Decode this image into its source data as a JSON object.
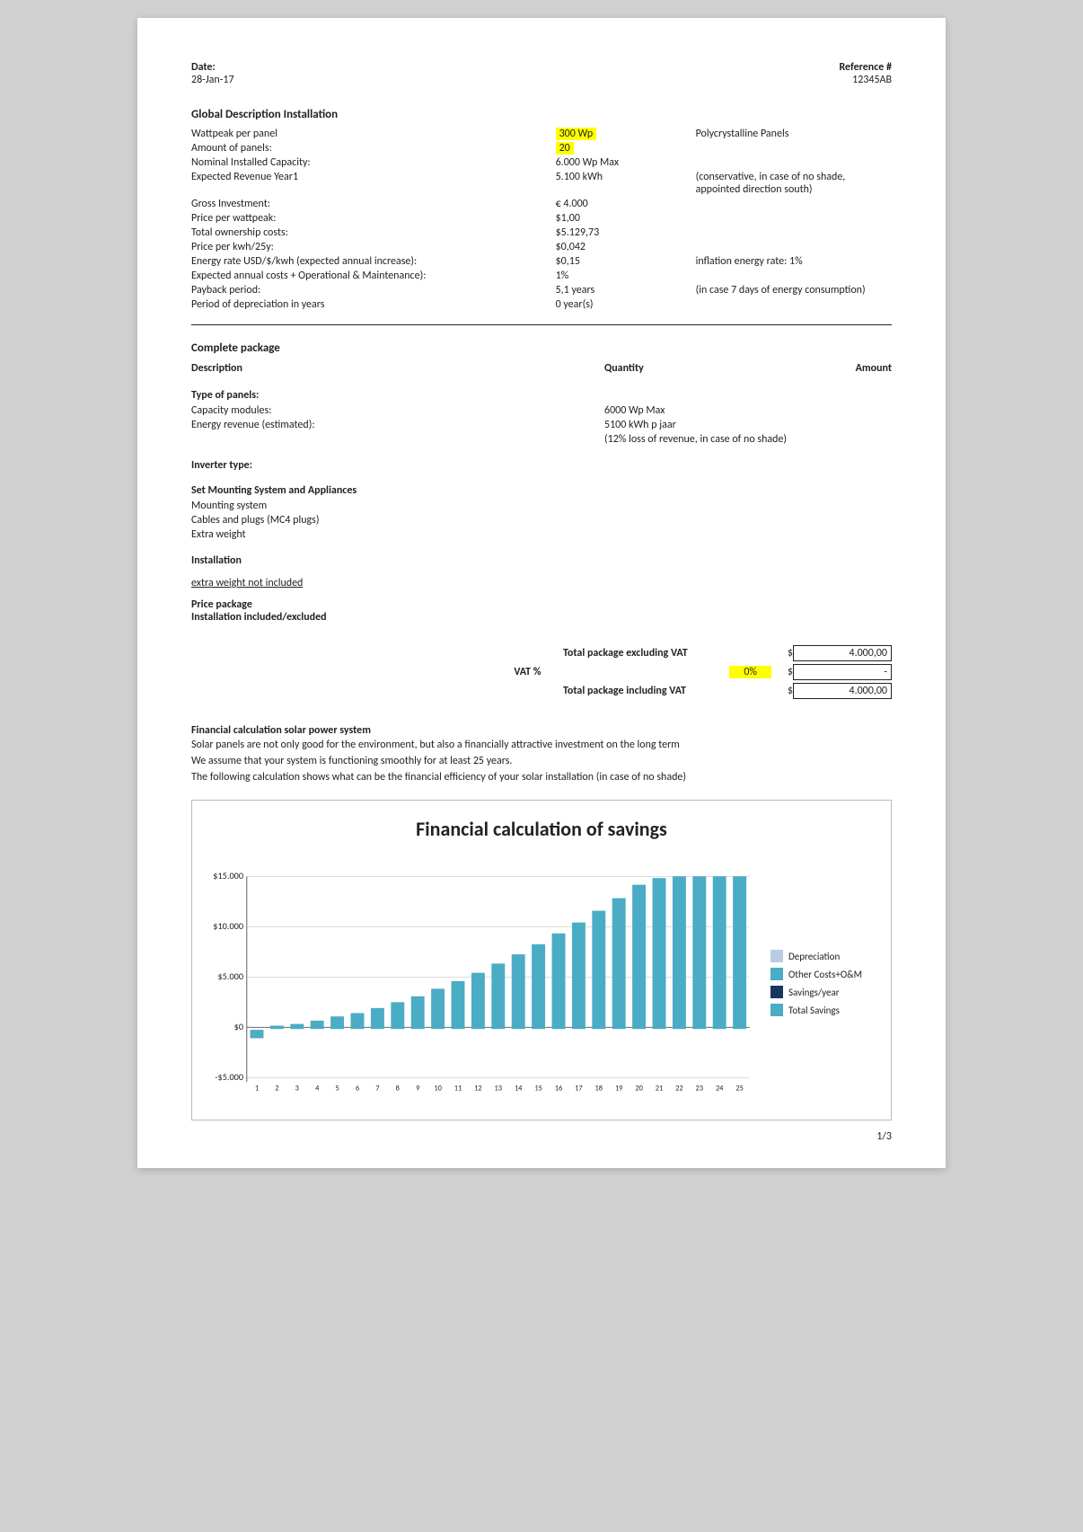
{
  "header": {
    "date_label": "Date:",
    "date_value": "28-Jan-17",
    "ref_label": "Reference #",
    "ref_value": "12345AB"
  },
  "global": {
    "section_title": "Global Description Installation",
    "rows": [
      {
        "label": "Wattpeak per panel",
        "value": "300 Wp",
        "value_highlight": true,
        "extra": "Polycrystalline Panels"
      },
      {
        "label": "Amount of panels:",
        "value": "20",
        "value_highlight": true,
        "extra": ""
      },
      {
        "label": "Nominal Installed Capacity:",
        "value": "6.000 Wp Max",
        "value_highlight": false,
        "extra": ""
      },
      {
        "label": "Expected Revenue Year1",
        "value": "5.100 kWh",
        "value_highlight": false,
        "extra": "(conservative, in case of no shade, appointed direction south)"
      },
      {
        "label": "Gross Investment:",
        "value": "€ 4.000",
        "value_highlight": false,
        "extra": ""
      },
      {
        "label": "Price per wattpeak:",
        "value": "$1,00",
        "value_highlight": false,
        "extra": ""
      },
      {
        "label": "Total ownership costs:",
        "value": "$5.129,73",
        "value_highlight": false,
        "extra": ""
      },
      {
        "label": "Price per kwh/25y:",
        "value": "$0,042",
        "value_highlight": false,
        "extra": ""
      },
      {
        "label": "Energy rate USD/$/kwh (expected annual increase):",
        "value": "$0,15",
        "value_highlight": false,
        "extra": "inflation energy rate:   1%"
      },
      {
        "label": "Expected annual costs + Operational & Maintenance):",
        "value": "1%",
        "value_highlight": false,
        "extra": ""
      },
      {
        "label": "Payback period:",
        "value": "5,1 years",
        "value_highlight": false,
        "extra": "(in case 7 days of energy consumption)"
      },
      {
        "label": "Period of depreciation in years",
        "value": "0 year(s)",
        "value_highlight": false,
        "extra": ""
      }
    ]
  },
  "package": {
    "section_title": "Complete package",
    "col_desc": "Description",
    "col_qty": "Quantity",
    "col_amt": "Amount",
    "sections": [
      {
        "title": "Type of panels:",
        "rows": [
          {
            "desc": "Capacity modules:",
            "qty": "6000 Wp Max",
            "amt": ""
          },
          {
            "desc": "Energy revenue (estimated):",
            "qty": "5100 kWh p jaar",
            "amt": ""
          },
          {
            "desc": "",
            "qty": "(12% loss of revenue, in case of no shade)",
            "amt": ""
          }
        ]
      },
      {
        "title": "Inverter type:",
        "rows": []
      },
      {
        "title": "Set Mounting System and Appliances",
        "rows": [
          {
            "desc": "Mounting system",
            "qty": "",
            "amt": ""
          },
          {
            "desc": "Cables and plugs (MC4 plugs)",
            "qty": "",
            "amt": ""
          },
          {
            "desc": "Extra weight",
            "qty": "",
            "amt": ""
          }
        ]
      },
      {
        "title": "Installation",
        "rows": []
      }
    ],
    "underline_text": "extra weight not included",
    "price_package_label": "Price package",
    "installation_label": "Installation included/excluded"
  },
  "totals": {
    "excl_label": "Total package excluding VAT",
    "excl_currency": "$",
    "excl_amount": "4.000,00",
    "vat_label": "VAT %",
    "vat_pct": "0%",
    "vat_currency": "$",
    "vat_amount": "-",
    "incl_label": "Total package including VAT",
    "incl_currency": "$",
    "incl_amount": "4.000,00"
  },
  "financial": {
    "section_title": "Financial calculation solar power system",
    "desc_lines": [
      "Solar panels are not only good for the environment, but also a financially attractive investment on the long term",
      "We assume that your system is functioning smoothly for at least 25 years.",
      "The following calculation shows what can be the financial efficiency of your solar installation (in case of no shade)"
    ],
    "chart_title": "Financial calculation of savings",
    "y_labels": [
      "$15.000",
      "$10.000",
      "$5.000",
      "$0",
      "-$5.000"
    ],
    "x_labels": [
      "1",
      "2",
      "3",
      "4",
      "5",
      "6",
      "7",
      "8",
      "9",
      "10",
      "11",
      "12",
      "13",
      "14",
      "15",
      "16",
      "17",
      "18",
      "19",
      "20",
      "21",
      "22",
      "23",
      "24",
      "25"
    ],
    "legend": [
      {
        "label": "Depreciation",
        "color": "#b8cce4"
      },
      {
        "label": "Other Costs+O&M",
        "color": "#4bacc6"
      },
      {
        "label": "Savings/year",
        "color": "#17375e"
      },
      {
        "label": "Total Savings",
        "color": "#4bacc6"
      }
    ]
  },
  "page_number": "1/3"
}
